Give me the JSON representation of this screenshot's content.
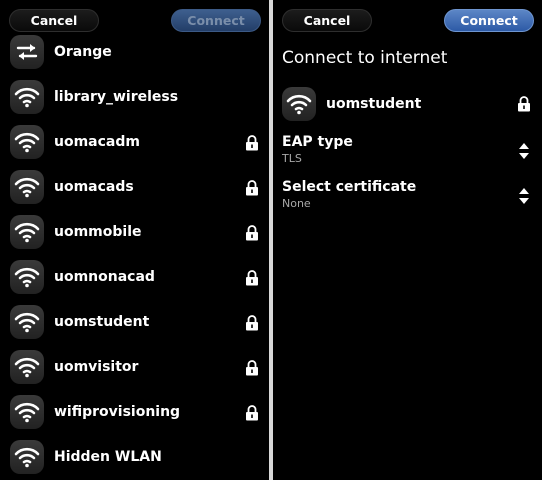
{
  "left": {
    "toolbar": {
      "cancel_label": "Cancel",
      "connect_label": "Connect",
      "connect_enabled": false
    },
    "networks": [
      {
        "name": "Orange",
        "icon": "swap-arrows-icon",
        "locked": false
      },
      {
        "name": "library_wireless",
        "icon": "wifi-icon",
        "locked": false
      },
      {
        "name": "uomacadm",
        "icon": "wifi-icon",
        "locked": true
      },
      {
        "name": "uomacads",
        "icon": "wifi-icon",
        "locked": true
      },
      {
        "name": "uommobile",
        "icon": "wifi-icon",
        "locked": true
      },
      {
        "name": "uomnonacad",
        "icon": "wifi-icon",
        "locked": true
      },
      {
        "name": "uomstudent",
        "icon": "wifi-icon",
        "locked": true
      },
      {
        "name": "uomvisitor",
        "icon": "wifi-icon",
        "locked": true
      },
      {
        "name": "wifiprovisioning",
        "icon": "wifi-icon",
        "locked": true
      },
      {
        "name": "Hidden WLAN",
        "icon": "wifi-icon",
        "locked": false
      }
    ]
  },
  "right": {
    "toolbar": {
      "cancel_label": "Cancel",
      "connect_label": "Connect",
      "connect_enabled": true
    },
    "title": "Connect to internet",
    "network": {
      "name": "uomstudent",
      "icon": "wifi-icon",
      "locked": true
    },
    "eap": {
      "label": "EAP type",
      "value": "TLS"
    },
    "certificate": {
      "label": "Select certificate",
      "value": "None"
    }
  },
  "colors": {
    "accent": "#3a6bb8",
    "background": "#000000",
    "secondary_text": "#a8a8a8"
  }
}
